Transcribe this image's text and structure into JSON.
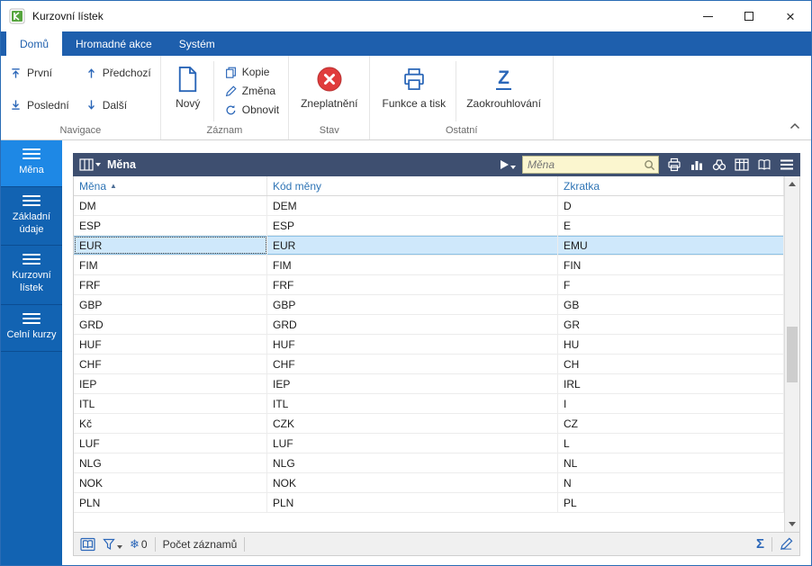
{
  "window": {
    "title": "Kurzovní lístek"
  },
  "tabs": [
    {
      "label": "Domů",
      "active": true
    },
    {
      "label": "Hromadné akce",
      "active": false
    },
    {
      "label": "Systém",
      "active": false
    }
  ],
  "ribbon": {
    "groups": [
      {
        "label": "Navigace",
        "items": [
          {
            "label": "První",
            "icon": "first-arrow-up-bar-icon"
          },
          {
            "label": "Poslední",
            "icon": "last-arrow-down-bar-icon"
          },
          {
            "label": "Předchozí",
            "icon": "previous-arrow-up-icon"
          },
          {
            "label": "Další",
            "icon": "next-arrow-down-icon"
          }
        ]
      },
      {
        "label": "Záznam",
        "big_items": [
          {
            "label": "Nový",
            "icon": "new-document-icon"
          }
        ],
        "items": [
          {
            "label": "Kopie",
            "icon": "copy-icon"
          },
          {
            "label": "Změna",
            "icon": "edit-pencil-icon"
          },
          {
            "label": "Obnovit",
            "icon": "refresh-icon"
          }
        ]
      },
      {
        "label": "Stav",
        "big_items": [
          {
            "label": "Zneplatnění",
            "icon": "invalidate-red-x-icon"
          }
        ]
      },
      {
        "label": "Ostatní",
        "big_items": [
          {
            "label": "Funkce a tisk",
            "icon": "printer-icon"
          },
          {
            "label": "Zaokrouhlování",
            "icon": "rounding-z-icon"
          }
        ]
      }
    ]
  },
  "sidebar": {
    "items": [
      {
        "label": "Měna",
        "active": true
      },
      {
        "label": "Základní údaje",
        "active": false
      },
      {
        "label": "Kurzovní lístek",
        "active": false
      },
      {
        "label": "Celní kurzy",
        "active": false
      }
    ]
  },
  "grid": {
    "title": "Měna",
    "search": {
      "placeholder": "Měna",
      "value": ""
    },
    "columns": [
      {
        "label": "Měna",
        "sorted": "asc",
        "sort_indicator": "▲"
      },
      {
        "label": "Kód měny",
        "sorted": ""
      },
      {
        "label": "Zkratka",
        "sorted": ""
      }
    ],
    "rows": [
      [
        "DM",
        "DEM",
        "D"
      ],
      [
        "ESP",
        "ESP",
        "E"
      ],
      [
        "EUR",
        "EUR",
        "EMU"
      ],
      [
        "FIM",
        "FIM",
        "FIN"
      ],
      [
        "FRF",
        "FRF",
        "F"
      ],
      [
        "GBP",
        "GBP",
        "GB"
      ],
      [
        "GRD",
        "GRD",
        "GR"
      ],
      [
        "HUF",
        "HUF",
        "HU"
      ],
      [
        "CHF",
        "CHF",
        "CH"
      ],
      [
        "IEP",
        "IEP",
        "IRL"
      ],
      [
        "ITL",
        "ITL",
        "I"
      ],
      [
        "Kč",
        "CZK",
        "CZ"
      ],
      [
        "LUF",
        "LUF",
        "L"
      ],
      [
        "NLG",
        "NLG",
        "NL"
      ],
      [
        "NOK",
        "NOK",
        "N"
      ],
      [
        "PLN",
        "PLN",
        "PL"
      ]
    ],
    "selected_index": 2
  },
  "statusbar": {
    "filter_count": "0",
    "count_label": "Počet záznamů",
    "snowflake_glyph": "❄",
    "sigma_glyph": "Σ"
  },
  "colors": {
    "accent_blue": "#1e5fad",
    "sidebar_blue": "#1263b2",
    "sidebar_active": "#1e88e5",
    "grid_header_navy": "#3e4f70",
    "selected_row": "#cfe8fb",
    "invalid_red": "#e03c3c",
    "search_bg": "#fbf6cf",
    "icon_blue": "#2a66b8"
  }
}
